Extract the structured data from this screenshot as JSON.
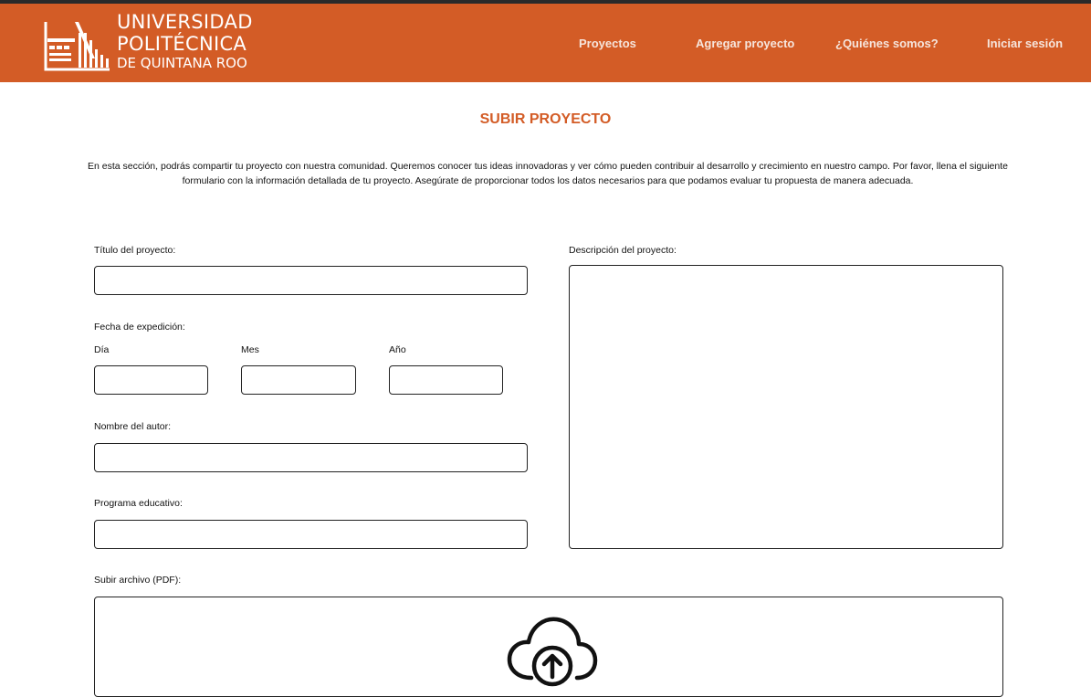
{
  "header": {
    "logo": {
      "line1": "UNIVERSIDAD",
      "line2": "POLITÉCNICA",
      "line3": "DE QUINTANA ROO"
    },
    "nav": [
      {
        "label": "Proyectos"
      },
      {
        "label": "Agregar proyecto"
      },
      {
        "label": "¿Quiénes somos?"
      },
      {
        "label": "Iniciar sesión"
      }
    ]
  },
  "page": {
    "title": "SUBIR PROYECTO",
    "intro": "En esta sección, podrás compartir tu proyecto con nuestra comunidad. Queremos conocer tus ideas innovadoras y ver cómo pueden contribuir al desarrollo y crecimiento en nuestro campo. Por favor, llena el siguiente formulario con la información detallada de tu proyecto. Asegúrate de proporcionar todos los datos necesarios para que podamos evaluar tu propuesta de manera adecuada."
  },
  "form": {
    "title_label": "Título del proyecto:",
    "title_value": "",
    "date_label": "Fecha de expedición:",
    "day_label": "Día",
    "month_label": "Mes",
    "year_label": "Año",
    "day_value": "",
    "month_value": "",
    "year_value": "",
    "author_label": "Nombre del autor:",
    "author_value": "",
    "program_label": "Programa educativo:",
    "program_value": "",
    "description_label": "Descripción del proyecto:",
    "description_value": "",
    "file_label": "Subir archivo (PDF):"
  },
  "icons": {
    "upload": "cloud-upload-icon",
    "logo": "building-logo-icon"
  },
  "colors": {
    "brand": "#d35c26",
    "nav_text": "#f6e5dc",
    "topbar": "#2a2a2a"
  }
}
